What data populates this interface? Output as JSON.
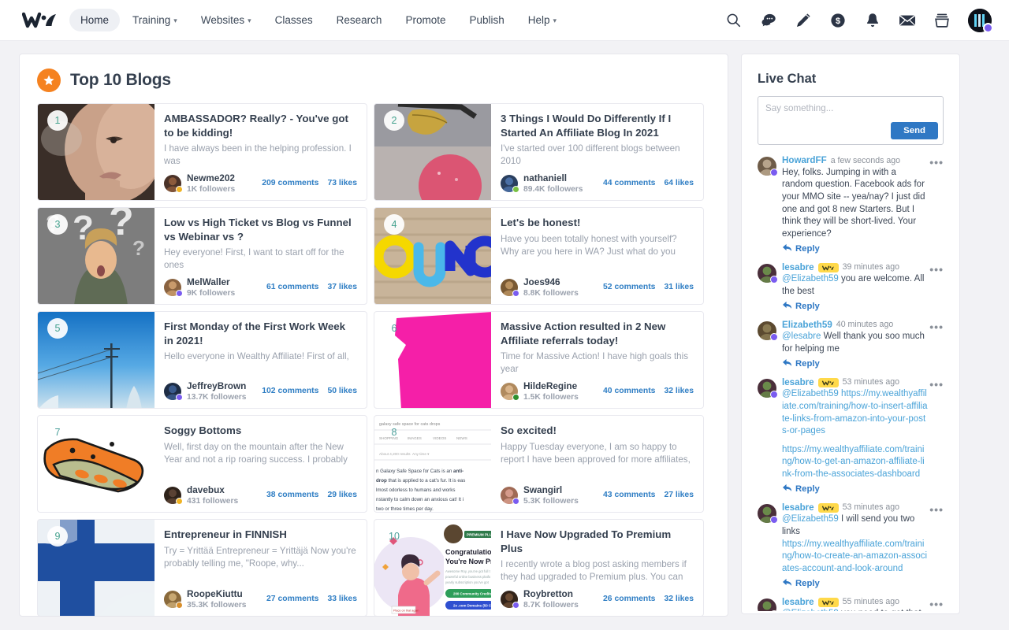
{
  "nav": {
    "logo_name": "wa-logo",
    "items": [
      {
        "label": "Home",
        "active": true,
        "caret": false
      },
      {
        "label": "Training",
        "active": false,
        "caret": true
      },
      {
        "label": "Websites",
        "active": false,
        "caret": true
      },
      {
        "label": "Classes",
        "active": false,
        "caret": false
      },
      {
        "label": "Research",
        "active": false,
        "caret": false
      },
      {
        "label": "Promote",
        "active": false,
        "caret": false
      },
      {
        "label": "Publish",
        "active": false,
        "caret": false
      },
      {
        "label": "Help",
        "active": false,
        "caret": true
      }
    ],
    "icons": [
      "search-icon",
      "chat-icon",
      "pencil-icon",
      "dollar-icon",
      "bell-icon",
      "mail-icon",
      "inbox-icon"
    ]
  },
  "main": {
    "section_title": "Top 10 Blogs",
    "section_icon": "star-icon",
    "cards": [
      {
        "rank": "1",
        "title": "AMBASSADOR? Really? - You've got to be kidding!",
        "excerpt": "I have always been in the helping profession. I was",
        "author": "Newme202",
        "followers": "1K followers",
        "comments": "209 comments",
        "likes": "73 likes",
        "thumb_kind": "photo-face",
        "thumb_colors": [
          "#6b5a50",
          "#c9a189",
          "#3a2e28"
        ],
        "badge_color": "#f0b323",
        "av_colors": [
          "#8b5a3c",
          "#4a3228"
        ],
        "rank_bare": false
      },
      {
        "rank": "2",
        "title": "3 Things I Would Do Differently If I Started An Affiliate Blog In 2021",
        "excerpt": "I've started over 100 different blogs between 2010",
        "author": "nathaniell",
        "followers": "89.4K followers",
        "comments": "44 comments",
        "likes": "64 likes",
        "thumb_kind": "photo-leaf",
        "thumb_colors": [
          "#9a9aa0",
          "#c7a43f",
          "#d94f6e"
        ],
        "badge_color": "#7ac143",
        "av_colors": [
          "#4a6fa5",
          "#2a3f5f"
        ],
        "rank_bare": false
      },
      {
        "rank": "3",
        "title": "Low vs High Ticket vs Blog vs Funnel vs Webinar vs ?",
        "excerpt": "Hey everyone! First, I want to start off for the ones",
        "author": "MelWaller",
        "followers": "9K followers",
        "comments": "61 comments",
        "likes": "37 likes",
        "thumb_kind": "photo-question",
        "thumb_colors": [
          "#7d7d7d",
          "#e8e8e8",
          "#5f6b55"
        ],
        "badge_color": "#7a5cf0",
        "av_colors": [
          "#c89a6b",
          "#8a6340"
        ],
        "rank_bare": false
      },
      {
        "rank": "4",
        "title": "Let's be honest!",
        "excerpt": "Have you been totally honest with yourself? Why are you here in WA? Just what do you expect to",
        "author": "Joes946",
        "followers": "8.8K followers",
        "comments": "52 comments",
        "likes": "31 likes",
        "thumb_kind": "photo-one",
        "thumb_colors": [
          "#c8b49a",
          "#f5d800",
          "#2233cc"
        ],
        "badge_color": "#7a5cf0",
        "av_colors": [
          "#b9915f",
          "#7a5a34"
        ],
        "rank_bare": false
      },
      {
        "rank": "5",
        "title": "First Monday of the First Work Week in 2021!",
        "excerpt": "Hello everyone in Wealthy Affiliate! First of all,",
        "author": "JeffreyBrown",
        "followers": "13.7K followers",
        "comments": "102 comments",
        "likes": "50 likes",
        "thumb_kind": "photo-sky",
        "thumb_colors": [
          "#1b82d6",
          "#7cc4f0",
          "#dde8f0"
        ],
        "badge_color": "#7a5cf0",
        "av_colors": [
          "#3a5a8c",
          "#1e2d45"
        ],
        "rank_bare": false
      },
      {
        "rank": "6",
        "title": "Massive Action resulted in 2 New Affiliate referrals today!",
        "excerpt": "Time for Massive Action! I have high goals this year",
        "author": "HildeRegine",
        "followers": "1.5K followers",
        "comments": "40 comments",
        "likes": "32 likes",
        "thumb_kind": "photo-pink",
        "thumb_colors": [
          "#ffffff",
          "#f51fa8",
          "#ffffff"
        ],
        "badge_color": "#2f8f2f",
        "av_colors": [
          "#d9b48a",
          "#b08a5e"
        ],
        "rank_bare": true
      },
      {
        "rank": "7",
        "title": "Soggy Bottoms",
        "excerpt": "Well, first day on the mountain after the New Year and not a rip roaring success. I probably got off...",
        "author": "davebux",
        "followers": "431 followers",
        "comments": "38 comments",
        "likes": "29 likes",
        "thumb_kind": "illus-pie",
        "thumb_colors": [
          "#ffffff",
          "#f07d26",
          "#9aa06a"
        ],
        "badge_color": "#f0b323",
        "av_colors": [
          "#5a4234",
          "#2e221a"
        ],
        "rank_bare": true
      },
      {
        "rank": "8",
        "title": "So excited!",
        "excerpt": "Happy Tuesday everyone, I am so happy to report I have been approved for more affiliates, updated",
        "author": "Swangirl",
        "followers": "5.3K followers",
        "comments": "43 comments",
        "likes": "27 likes",
        "thumb_kind": "screenshot-serp",
        "thumb_colors": [
          "#ffffff",
          "#e4e4e8",
          "#3d4756"
        ],
        "badge_color": "#7a5cf0",
        "av_colors": [
          "#d59a8a",
          "#a06a55"
        ],
        "rank_bare": true
      },
      {
        "rank": "9",
        "title": "Entrepreneur in FINNISH",
        "excerpt": "Try = Yrittää Entrepreneur = Yrittäjä Now you're probably telling me, \"Roope, why...",
        "author": "RoopeKiuttu",
        "followers": "35.3K followers",
        "comments": "27 comments",
        "likes": "33 likes",
        "thumb_kind": "photo-flag",
        "thumb_colors": [
          "#eef2f6",
          "#1f4fa0",
          "#ffffff"
        ],
        "badge_color": "#d98f2b",
        "av_colors": [
          "#c8a872",
          "#8a6a3c"
        ],
        "rank_bare": false
      },
      {
        "rank": "10",
        "title": "I Have Now Upgraded To Premium Plus",
        "excerpt": "I recently wrote a blog post asking members if they had upgraded to Premium plus. You can see the",
        "author": "Roybretton",
        "followers": "8.7K followers",
        "comments": "26 comments",
        "likes": "32 likes",
        "thumb_kind": "screenshot-congrats",
        "thumb_colors": [
          "#ffffff",
          "#ef6a8a",
          "#2f4fd0"
        ],
        "badge_color": "#7a5cf0",
        "av_colors": [
          "#6a4a32",
          "#33241a"
        ],
        "rank_bare": true
      }
    ]
  },
  "chat": {
    "title": "Live Chat",
    "input_placeholder": "Say something...",
    "input_value": "",
    "send_label": "Send",
    "reply_label": "Reply",
    "more_label": "•••",
    "messages": [
      {
        "user": "HowardFF",
        "wa_badge": false,
        "time": "a few seconds ago",
        "mention": "",
        "text": "Hey, folks. Jumping in with a random question. Facebook ads for your MMO site -- yea/nay? I just did one and got 8 new Starters. But I think they will be short-lived. Your experience?",
        "links": [],
        "badge_color": "#7a5cf0",
        "av_colors": [
          "#b8a48c",
          "#6f5c48"
        ]
      },
      {
        "user": "lesabre",
        "wa_badge": true,
        "time": "39 minutes ago",
        "mention": "@Elizabeth59",
        "text": " you are welcome. All the best",
        "links": [],
        "badge_color": "#7a5cf0",
        "av_colors": [
          "#6a8a4a",
          "#4a2f3a"
        ]
      },
      {
        "user": "Elizabeth59",
        "wa_badge": false,
        "time": "40 minutes ago",
        "mention": "@lesabre",
        "text": " Well thank you soo much for helping me",
        "links": [],
        "badge_color": "#7a5cf0",
        "av_colors": [
          "#8a7a52",
          "#5c4a30"
        ]
      },
      {
        "user": "lesabre",
        "wa_badge": true,
        "time": "53 minutes ago",
        "mention": "@Elizabeth59",
        "text": " ",
        "links": [
          "https://my.wealthyaffiliate.com/training/how-to-insert-affiliate-links-from-amazon-into-your-posts-or-pages",
          "https://my.wealthyaffiliate.com/training/how-to-get-an-amazon-affiliate-link-from-the-associates-dashboard"
        ],
        "first_link_inline": true,
        "badge_color": "#7a5cf0",
        "av_colors": [
          "#6a8a4a",
          "#4a2f3a"
        ]
      },
      {
        "user": "lesabre",
        "wa_badge": true,
        "time": "53 minutes ago",
        "mention": "@Elizabeth59",
        "text": " I will send you two links",
        "links": [
          "https://my.wealthyaffiliate.com/training/how-to-create-an-amazon-associates-account-and-look-around"
        ],
        "link_tight": true,
        "badge_color": "#7a5cf0",
        "av_colors": [
          "#6a8a4a",
          "#4a2f3a"
        ]
      },
      {
        "user": "lesabre",
        "wa_badge": true,
        "time": "55 minutes ago",
        "mention": "@Elizabeth59",
        "text": " you need to get that",
        "links": [],
        "no_reply": true,
        "badge_color": "#7a5cf0",
        "av_colors": [
          "#6a8a4a",
          "#4a2f3a"
        ]
      }
    ]
  },
  "colors": {
    "accent_blue": "#2f78c4",
    "link_blue": "#4aa3d8",
    "orange": "#f58220",
    "badge_yellow": "#ffd94a",
    "text_dark": "#35404f",
    "text_muted": "#9aa1ad",
    "page_bg": "#f2f2f5"
  }
}
